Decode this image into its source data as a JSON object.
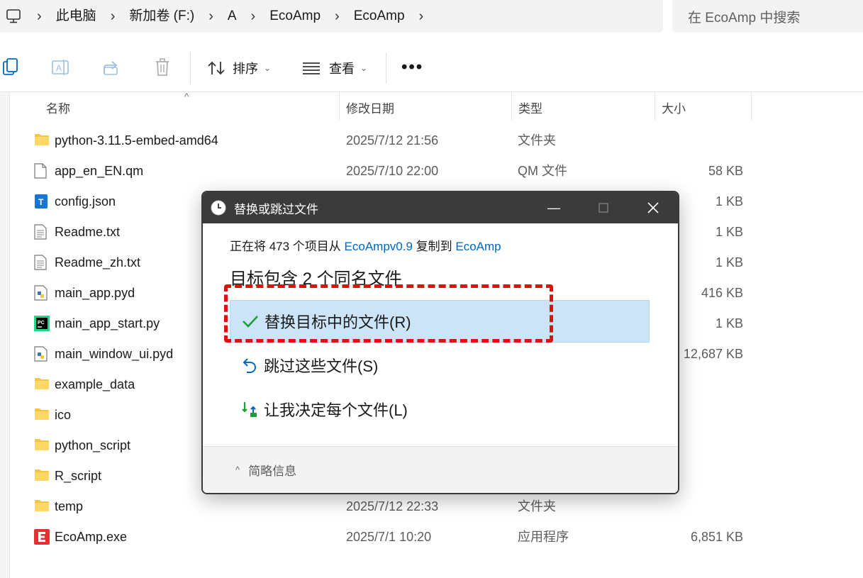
{
  "address_bar": {
    "icon": "computer-icon",
    "crumbs": [
      "此电脑",
      "新加卷 (F:)",
      "A",
      "EcoAmp",
      "EcoAmp"
    ]
  },
  "search": {
    "placeholder": "在 EcoAmp 中搜索"
  },
  "toolbar": {
    "icons": [
      "copy-icon",
      "rename-icon",
      "share-icon",
      "delete-icon"
    ],
    "sort_label": "排序",
    "view_label": "查看",
    "more_label": "•••"
  },
  "columns": {
    "name": "名称",
    "modified": "修改日期",
    "type": "类型",
    "size": "大小"
  },
  "files": [
    {
      "name": "python-3.11.5-embed-amd64",
      "date": "2025/7/12 21:56",
      "type": "文件夹",
      "size": "",
      "icon": "folder-icon"
    },
    {
      "name": "app_en_EN.qm",
      "date": "2025/7/10 22:00",
      "type": "QM 文件",
      "size": "58 KB",
      "icon": "file-icon"
    },
    {
      "name": "config.json",
      "date": "",
      "type": "",
      "size": "1 KB",
      "icon": "json-file-icon"
    },
    {
      "name": "Readme.txt",
      "date": "",
      "type": "",
      "size": "1 KB",
      "icon": "text-file-icon"
    },
    {
      "name": "Readme_zh.txt",
      "date": "",
      "type": "",
      "size": "1 KB",
      "icon": "text-file-icon"
    },
    {
      "name": "main_app.pyd",
      "date": "",
      "type": "",
      "size": "416 KB",
      "icon": "python-file-icon"
    },
    {
      "name": "main_app_start.py",
      "date": "",
      "type": "",
      "size": "1 KB",
      "icon": "pycharm-file-icon"
    },
    {
      "name": "main_window_ui.pyd",
      "date": "",
      "type": "",
      "size": "12,687 KB",
      "icon": "python-file-icon"
    },
    {
      "name": "example_data",
      "date": "",
      "type": "",
      "size": "",
      "icon": "folder-icon"
    },
    {
      "name": "ico",
      "date": "",
      "type": "",
      "size": "",
      "icon": "folder-icon"
    },
    {
      "name": "python_script",
      "date": "",
      "type": "",
      "size": "",
      "icon": "folder-icon"
    },
    {
      "name": "R_script",
      "date": "",
      "type": "",
      "size": "",
      "icon": "folder-icon"
    },
    {
      "name": "temp",
      "date": "2025/7/12 22:33",
      "type": "文件夹",
      "size": "",
      "icon": "folder-icon"
    },
    {
      "name": "EcoAmp.exe",
      "date": "2025/7/1 10:20",
      "type": "应用程序",
      "size": "6,851 KB",
      "icon": "ecoamp-app-icon"
    }
  ],
  "dialog": {
    "title": "替换或跳过文件",
    "copy_prefix": "正在将 473 个项目从 ",
    "copy_source": "EcoAmpv0.9",
    "copy_middle": " 复制到 ",
    "copy_dest": "EcoAmp",
    "headline": "目标包含 2 个同名文件",
    "options": [
      {
        "label": "替换目标中的文件(R)",
        "icon": "checkmark-icon",
        "selected": true
      },
      {
        "label": "跳过这些文件(S)",
        "icon": "skip-icon",
        "selected": false
      },
      {
        "label": "让我决定每个文件(L)",
        "icon": "decide-icon",
        "selected": false
      }
    ],
    "details_label": "简略信息"
  },
  "colors": {
    "accent": "#0067c0",
    "selection": "#cce4f7",
    "annotation": "#e01010",
    "titlebar": "#3b3b3b"
  }
}
